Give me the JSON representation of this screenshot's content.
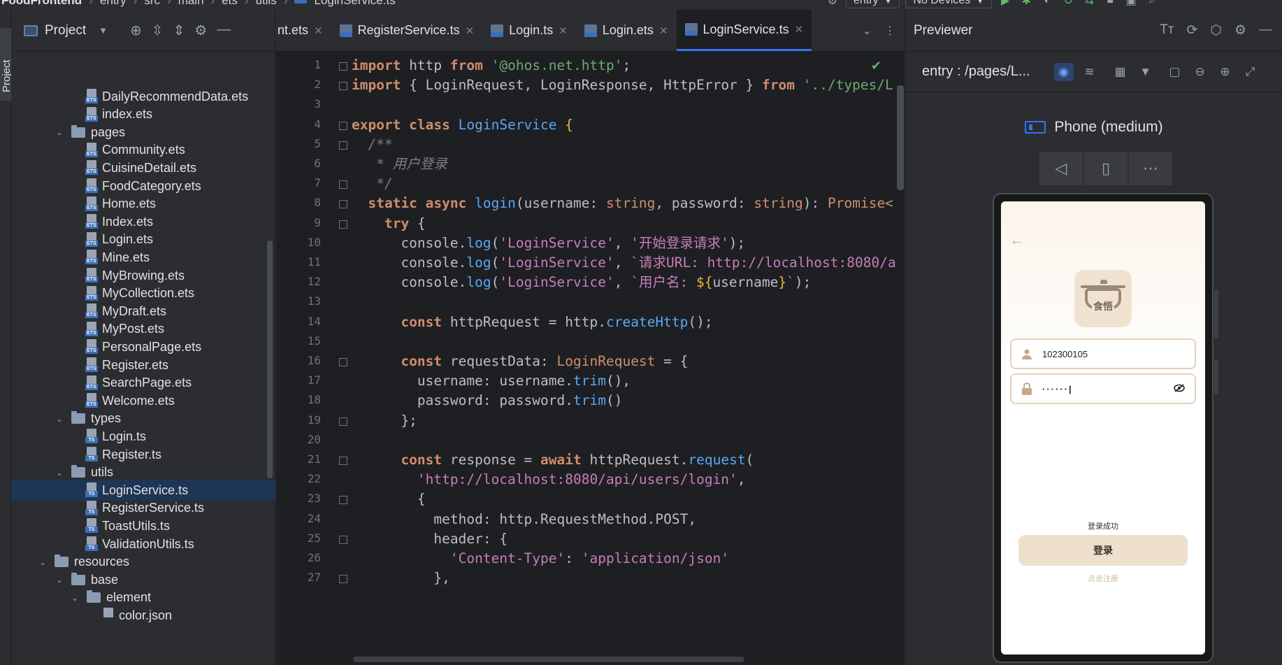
{
  "breadcrumb": [
    "FoodFrontend",
    "entry",
    "src",
    "main",
    "ets",
    "utils",
    "LoginService.ts"
  ],
  "toolbar": {
    "module": "entry",
    "device": "No Devices"
  },
  "sidebar_stripe": {
    "label": "Project"
  },
  "project_panel": {
    "title": "Project",
    "tree": [
      {
        "label": "DailyRecommendData.ets",
        "kind": "file",
        "ext": "ETS",
        "depth": 3
      },
      {
        "label": "index.ets",
        "kind": "file",
        "ext": "ETS",
        "depth": 3
      },
      {
        "label": "pages",
        "kind": "folder",
        "depth": 2,
        "expanded": true
      },
      {
        "label": "Community.ets",
        "kind": "file",
        "ext": "ETS",
        "depth": 3
      },
      {
        "label": "CuisineDetail.ets",
        "kind": "file",
        "ext": "ETS",
        "depth": 3
      },
      {
        "label": "FoodCategory.ets",
        "kind": "file",
        "ext": "ETS",
        "depth": 3
      },
      {
        "label": "Home.ets",
        "kind": "file",
        "ext": "ETS",
        "depth": 3
      },
      {
        "label": "Index.ets",
        "kind": "file",
        "ext": "ETS",
        "depth": 3
      },
      {
        "label": "Login.ets",
        "kind": "file",
        "ext": "ETS",
        "depth": 3
      },
      {
        "label": "Mine.ets",
        "kind": "file",
        "ext": "ETS",
        "depth": 3
      },
      {
        "label": "MyBrowing.ets",
        "kind": "file",
        "ext": "ETS",
        "depth": 3
      },
      {
        "label": "MyCollection.ets",
        "kind": "file",
        "ext": "ETS",
        "depth": 3
      },
      {
        "label": "MyDraft.ets",
        "kind": "file",
        "ext": "ETS",
        "depth": 3
      },
      {
        "label": "MyPost.ets",
        "kind": "file",
        "ext": "ETS",
        "depth": 3
      },
      {
        "label": "PersonalPage.ets",
        "kind": "file",
        "ext": "ETS",
        "depth": 3
      },
      {
        "label": "Register.ets",
        "kind": "file",
        "ext": "ETS",
        "depth": 3
      },
      {
        "label": "SearchPage.ets",
        "kind": "file",
        "ext": "ETS",
        "depth": 3
      },
      {
        "label": "Welcome.ets",
        "kind": "file",
        "ext": "ETS",
        "depth": 3
      },
      {
        "label": "types",
        "kind": "folder",
        "depth": 2,
        "expanded": true
      },
      {
        "label": "Login.ts",
        "kind": "file",
        "ext": "TS",
        "depth": 3
      },
      {
        "label": "Register.ts",
        "kind": "file",
        "ext": "TS",
        "depth": 3
      },
      {
        "label": "utils",
        "kind": "folder",
        "depth": 2,
        "expanded": true
      },
      {
        "label": "LoginService.ts",
        "kind": "file",
        "ext": "TS",
        "depth": 3,
        "selected": true
      },
      {
        "label": "RegisterService.ts",
        "kind": "file",
        "ext": "TS",
        "depth": 3
      },
      {
        "label": "ToastUtils.ts",
        "kind": "file",
        "ext": "TS",
        "depth": 3
      },
      {
        "label": "ValidationUtils.ts",
        "kind": "file",
        "ext": "TS",
        "depth": 3
      },
      {
        "label": "resources",
        "kind": "folder",
        "depth": 1,
        "expanded": true
      },
      {
        "label": "base",
        "kind": "folder",
        "depth": 2,
        "expanded": true
      },
      {
        "label": "element",
        "kind": "folder",
        "depth": 3,
        "expanded": true
      },
      {
        "label": "color.json",
        "kind": "file",
        "ext": "",
        "depth": 4
      }
    ]
  },
  "editor": {
    "tabs": [
      {
        "label": "nt.ets",
        "active": false
      },
      {
        "label": "RegisterService.ts",
        "active": false
      },
      {
        "label": "Login.ts",
        "active": false
      },
      {
        "label": "Login.ets",
        "active": false
      },
      {
        "label": "LoginService.ts",
        "active": true
      }
    ],
    "lines": [
      [
        [
          "kw",
          "import"
        ],
        [
          "pl",
          " http "
        ],
        [
          "kw",
          "from"
        ],
        [
          "pl",
          " "
        ],
        [
          "str",
          "'@ohos.net.http'"
        ],
        [
          "pl",
          ";"
        ]
      ],
      [
        [
          "kw",
          "import"
        ],
        [
          "pl",
          " { LoginRequest, LoginResponse, HttpError } "
        ],
        [
          "kw",
          "from"
        ],
        [
          "pl",
          " "
        ],
        [
          "str",
          "'../types/L"
        ]
      ],
      [],
      [
        [
          "kw",
          "export class"
        ],
        [
          "pl",
          " "
        ],
        [
          "cls",
          "LoginService"
        ],
        [
          "pl",
          " "
        ],
        [
          "brk",
          "{"
        ]
      ],
      [
        [
          "cm",
          "  /**"
        ]
      ],
      [
        [
          "cm",
          "   * 用户登录"
        ]
      ],
      [
        [
          "cm",
          "   */"
        ]
      ],
      [
        [
          "pl",
          "  "
        ],
        [
          "kw",
          "static async"
        ],
        [
          "pl",
          " "
        ],
        [
          "fn",
          "login"
        ],
        [
          "pl",
          "(username: "
        ],
        [
          "ty",
          "string"
        ],
        [
          "pl",
          ", password: "
        ],
        [
          "ty",
          "string"
        ],
        [
          "pl",
          "): "
        ],
        [
          "ty",
          "Promise<"
        ]
      ],
      [
        [
          "pl",
          "    "
        ],
        [
          "kw",
          "try"
        ],
        [
          "pl",
          " {"
        ]
      ],
      [
        [
          "pl",
          "      console."
        ],
        [
          "fn",
          "log"
        ],
        [
          "pl",
          "("
        ],
        [
          "str2",
          "'LoginService'"
        ],
        [
          "pl",
          ", "
        ],
        [
          "str2",
          "'开始登录请求'"
        ],
        [
          "pl",
          ");"
        ]
      ],
      [
        [
          "pl",
          "      console."
        ],
        [
          "fn",
          "log"
        ],
        [
          "pl",
          "("
        ],
        [
          "str2",
          "'LoginService'"
        ],
        [
          "pl",
          ", "
        ],
        [
          "str2",
          "`请求URL: http://localhost:8080/a"
        ]
      ],
      [
        [
          "pl",
          "      console."
        ],
        [
          "fn",
          "log"
        ],
        [
          "pl",
          "("
        ],
        [
          "str2",
          "'LoginService'"
        ],
        [
          "pl",
          ", "
        ],
        [
          "str2",
          "`用户名: "
        ],
        [
          "brk",
          "${"
        ],
        [
          "pl",
          "username"
        ],
        [
          "brk",
          "}"
        ],
        [
          "str2",
          "`"
        ],
        [
          "pl",
          ");"
        ]
      ],
      [],
      [
        [
          "pl",
          "      "
        ],
        [
          "kw",
          "const"
        ],
        [
          "pl",
          " httpRequest = http."
        ],
        [
          "fn",
          "createHttp"
        ],
        [
          "pl",
          "();"
        ]
      ],
      [],
      [
        [
          "pl",
          "      "
        ],
        [
          "kw",
          "const"
        ],
        [
          "pl",
          " requestData: "
        ],
        [
          "ty",
          "LoginRequest"
        ],
        [
          "pl",
          " = {"
        ]
      ],
      [
        [
          "pl",
          "        username: username."
        ],
        [
          "fn",
          "trim"
        ],
        [
          "pl",
          "(),"
        ]
      ],
      [
        [
          "pl",
          "        password: password."
        ],
        [
          "fn",
          "trim"
        ],
        [
          "pl",
          "()"
        ]
      ],
      [
        [
          "pl",
          "      };"
        ]
      ],
      [],
      [
        [
          "pl",
          "      "
        ],
        [
          "kw",
          "const"
        ],
        [
          "pl",
          " response = "
        ],
        [
          "kw",
          "await"
        ],
        [
          "pl",
          " httpRequest."
        ],
        [
          "fn",
          "request"
        ],
        [
          "pl",
          "("
        ]
      ],
      [
        [
          "pl",
          "        "
        ],
        [
          "str2",
          "'http://localhost:8080/api/users/login'"
        ],
        [
          "pl",
          ","
        ]
      ],
      [
        [
          "pl",
          "        {"
        ]
      ],
      [
        [
          "pl",
          "          method: http.RequestMethod.POST,"
        ]
      ],
      [
        [
          "pl",
          "          header: {"
        ]
      ],
      [
        [
          "pl",
          "            "
        ],
        [
          "str2",
          "'Content-Type'"
        ],
        [
          "pl",
          ": "
        ],
        [
          "str2",
          "'application/json'"
        ]
      ],
      [
        [
          "pl",
          "          },"
        ]
      ]
    ]
  },
  "previewer": {
    "title": "Previewer",
    "page_path": "entry : /pages/L...",
    "device_name": "Phone (medium)",
    "app": {
      "logo_text": "食悟",
      "username_value": "102300105",
      "password_mask": "······|",
      "toast": "登录成功",
      "login_button": "登录",
      "register_link": "点击注册"
    }
  }
}
